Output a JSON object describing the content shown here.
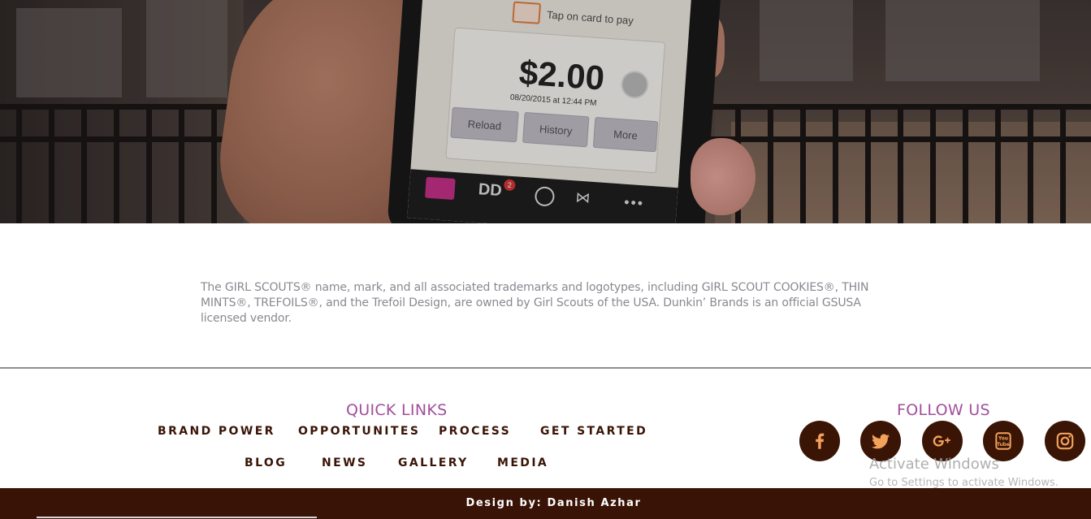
{
  "hero": {
    "tap_text": "Tap on card to pay",
    "amount": "$2.00",
    "date": "08/20/2015 at 12:44 PM",
    "buttons": [
      "Reload",
      "History",
      "More"
    ],
    "tab_label": "DD",
    "tab_badge": "2"
  },
  "disclaimer": "The GIRL SCOUTS® name, mark, and all associated trademarks and logotypes, including GIRL SCOUT COOKIES®, THIN MINTS®, TREFOILS®, and the Trefoil Design, are owned by Girl Scouts of the USA. Dunkin’ Brands is an official GSUSA licensed vendor.",
  "quick_links": {
    "title": "QUICK LINKS",
    "row1": [
      "BRAND POWER",
      "OPPORTUNITES",
      "PROCESS",
      "GET STARTED"
    ],
    "row2": [
      "BLOG",
      "NEWS",
      "GALLERY",
      "MEDIA"
    ]
  },
  "follow_us": {
    "title": "FOLLOW US",
    "icons": [
      "facebook-icon",
      "twitter-icon",
      "google-plus-icon",
      "youtube-icon",
      "instagram-icon"
    ]
  },
  "os_overlay": {
    "title": "Activate Windows",
    "subtitle": "Go to Settings to activate Windows."
  },
  "footer": {
    "credit": "Design by: Danish Azhar"
  },
  "colors": {
    "accent": "#a14f9c",
    "brown": "#3a1506"
  }
}
